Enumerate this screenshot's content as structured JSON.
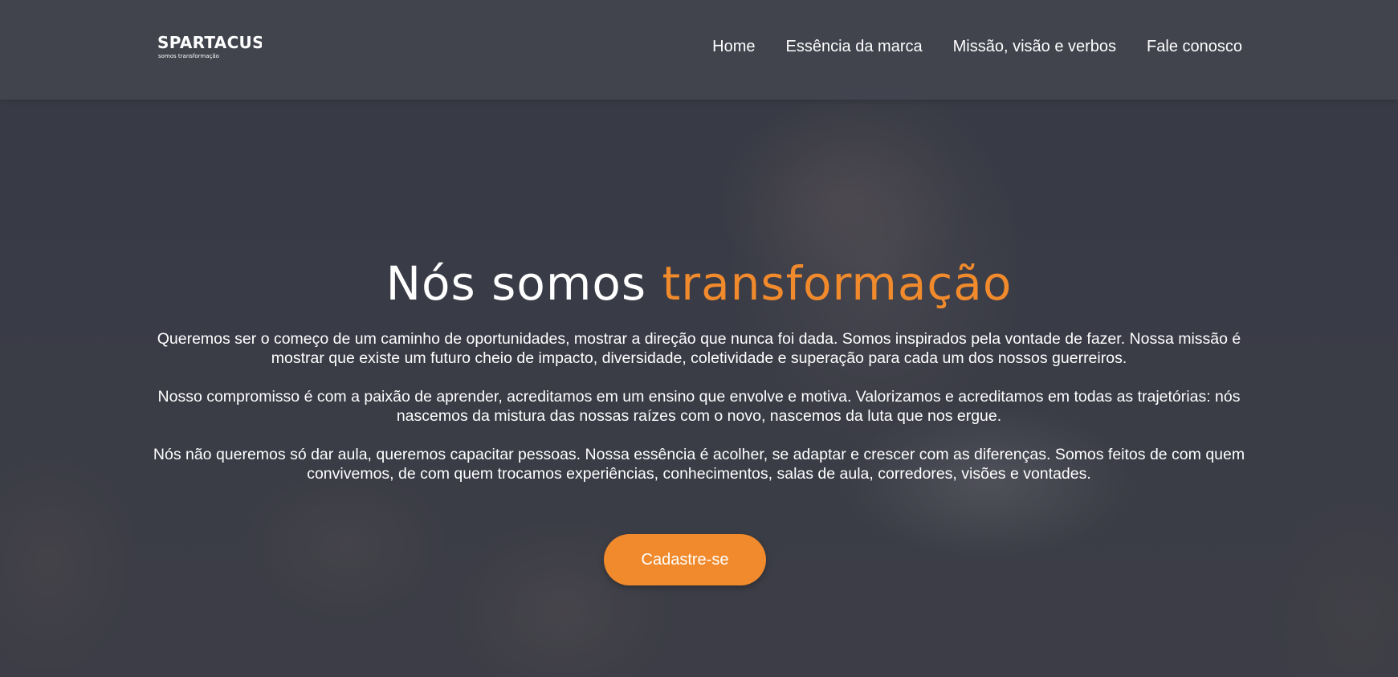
{
  "header": {
    "logo": {
      "text": "SPARTACUS",
      "tagline": "somos transformação"
    },
    "nav": [
      {
        "label": "Home"
      },
      {
        "label": "Essência da marca"
      },
      {
        "label": "Missão, visão e verbos"
      },
      {
        "label": "Fale conosco"
      }
    ]
  },
  "hero": {
    "title_prefix": "Nós somos",
    "title_accent": "transformação",
    "paragraphs": [
      "Queremos ser o começo de um caminho de oportunidades, mostrar a direção que nunca foi dada. Somos inspirados pela vontade de fazer. Nossa missão é mostrar que existe um futuro cheio de impacto, diversidade, coletividade e superação para cada um dos nossos guerreiros.",
      "Nosso compromisso é com a paixão de aprender, acreditamos em um ensino que envolve e motiva. Valorizamos e acreditamos em todas as trajetórias: nós nascemos da mistura das nossas raízes com o novo, nascemos da luta que nos ergue.",
      "Nós não queremos só dar aula, queremos capacitar pessoas. Nossa essência é acolher, se adaptar e crescer com as diferenças. Somos feitos de com quem convivemos, de com quem trocamos experiências, conhecimentos, salas de aula, corredores, visões e vontades."
    ],
    "cta_label": "Cadastre-se"
  },
  "colors": {
    "accent": "#f08a2c",
    "header_bg": "#42444e",
    "text": "#ffffff"
  }
}
